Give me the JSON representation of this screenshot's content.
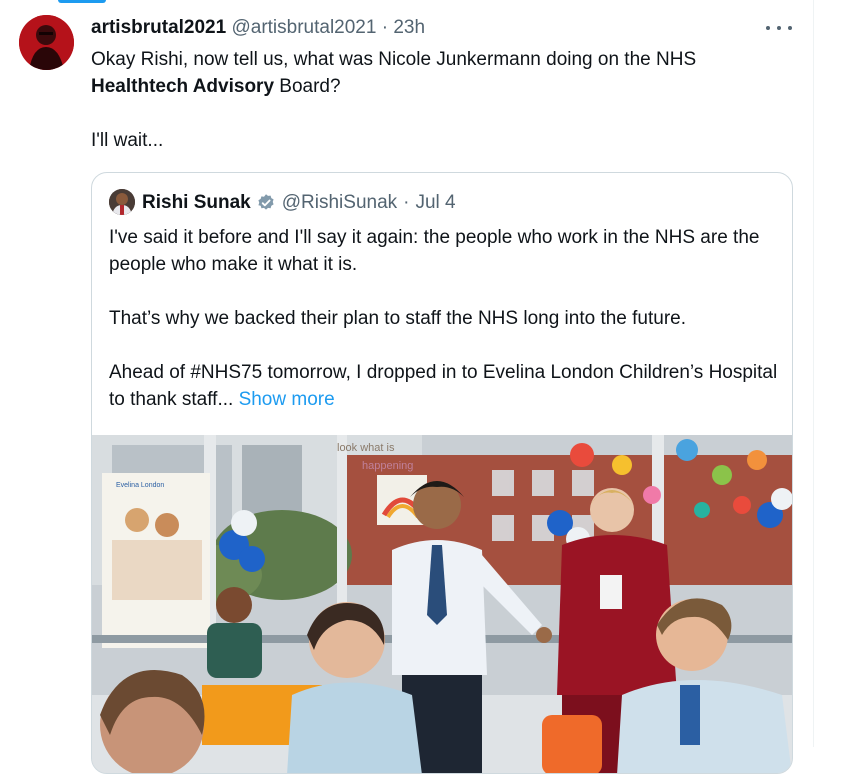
{
  "tweet": {
    "display_name": "artisbrutal2021",
    "handle": "@artisbrutal2021",
    "separator": "·",
    "time": "23h",
    "text_line1": "Okay Rishi,  now tell us, what was Nicole Junkermann doing on the NHS",
    "text_bold": "Healthtech Advisory",
    "text_after_bold": " Board?",
    "text_line3": "I'll wait..."
  },
  "quoted_tweet": {
    "display_name": "Rishi Sunak",
    "handle": "@RishiSunak",
    "separator": "·",
    "date": "Jul 4",
    "para1": "I've said it before and I'll say it again: the people who work in the NHS are the people who make it what it is.",
    "para2": "That’s why we backed their plan to staff the NHS long into the future.",
    "para3": "Ahead of #NHS75 tomorrow, I dropped in to Evelina London Children’s Hospital to thank staff...",
    "show_more": "Show more"
  },
  "photo": {
    "wall_text_1": "look what is",
    "wall_text_2": "happening",
    "poster_text": "Evelina London"
  },
  "icons": {
    "more": "more-horizontal-icon",
    "verified": "verified-badge-icon"
  },
  "colors": {
    "accent": "#1d9bf0",
    "text": "#0f1419",
    "muted": "#536471",
    "border": "#cfd9de"
  }
}
